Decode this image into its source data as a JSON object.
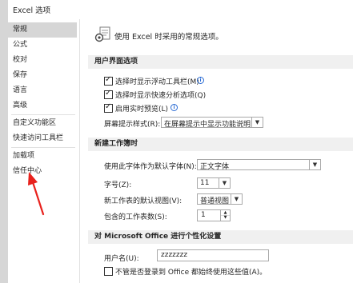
{
  "window": {
    "title": "Excel 选项"
  },
  "nav": {
    "items": [
      {
        "label": "常规"
      },
      {
        "label": "公式"
      },
      {
        "label": "校对"
      },
      {
        "label": "保存"
      },
      {
        "label": "语言"
      },
      {
        "label": "高级"
      },
      {
        "label": "自定义功能区"
      },
      {
        "label": "快速访问工具栏"
      },
      {
        "label": "加载项"
      },
      {
        "label": "信任中心"
      }
    ],
    "selected_index": 0
  },
  "header": {
    "text": "使用 Excel 时采用的常规选项。"
  },
  "ui_section": {
    "title": "用户界面选项",
    "mini_toolbar": {
      "label": "选择时显示浮动工具栏(M)",
      "checked": true
    },
    "quick_analysis": {
      "label": "选择时显示快速分析选项(Q)",
      "checked": true
    },
    "live_preview": {
      "label": "启用实时预览(L)",
      "checked": true
    },
    "screentip": {
      "label": "屏幕提示样式(R):",
      "value": "在屏幕提示中显示功能说明"
    }
  },
  "workbook_section": {
    "title": "新建工作簿时",
    "font": {
      "label": "使用此字体作为默认字体(N):",
      "value": "正文字体"
    },
    "size": {
      "label": "字号(Z):",
      "value": "11"
    },
    "view": {
      "label": "新工作表的默认视图(V):",
      "value": "普通视图"
    },
    "sheets": {
      "label": "包含的工作表数(S):",
      "value": "1"
    }
  },
  "personalize_section": {
    "title": "对 Microsoft Office 进行个性化设置",
    "username": {
      "label": "用户名(U):",
      "value": "zzzzzzz"
    },
    "always_use": {
      "label": "不管是否登录到 Office 都始终使用这些值(A)。",
      "checked": false
    }
  },
  "colors": {
    "nav_selected": "#d6d6d6",
    "section_bg": "#f0f0f0",
    "annotation_arrow": "#e8211c",
    "info_icon": "#2b6cd4"
  }
}
